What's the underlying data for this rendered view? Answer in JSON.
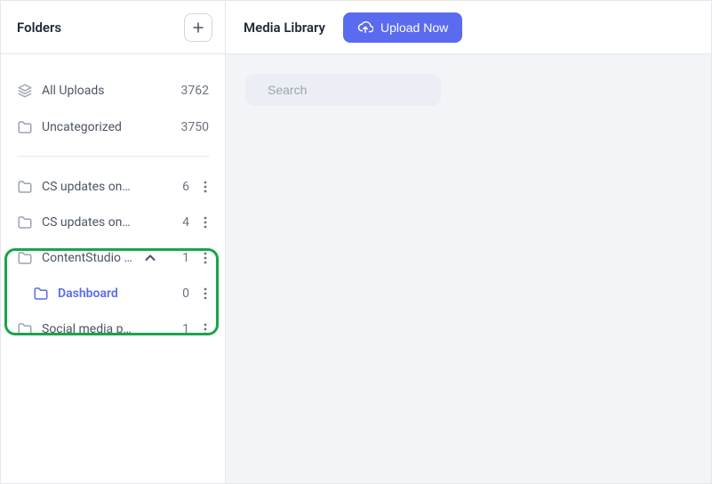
{
  "sidebar": {
    "title": "Folders",
    "top": [
      {
        "label": "All Uploads",
        "count": "3762",
        "icon": "layers-icon"
      },
      {
        "label": "Uncategorized",
        "count": "3750",
        "icon": "folder-icon"
      }
    ],
    "folders": [
      {
        "label": "CS updates on ...",
        "count": "6",
        "expanded": false
      },
      {
        "label": "CS updates on I...",
        "count": "4",
        "expanded": false
      },
      {
        "label": "ContentStudio ...",
        "count": "1",
        "expanded": true
      },
      {
        "label": "Social media po...",
        "count": "1",
        "expanded": false
      }
    ],
    "subfolder": {
      "label": "Dashboard",
      "count": "0"
    }
  },
  "main": {
    "title": "Media Library",
    "upload_label": "Upload Now"
  },
  "search": {
    "placeholder": "Search"
  }
}
